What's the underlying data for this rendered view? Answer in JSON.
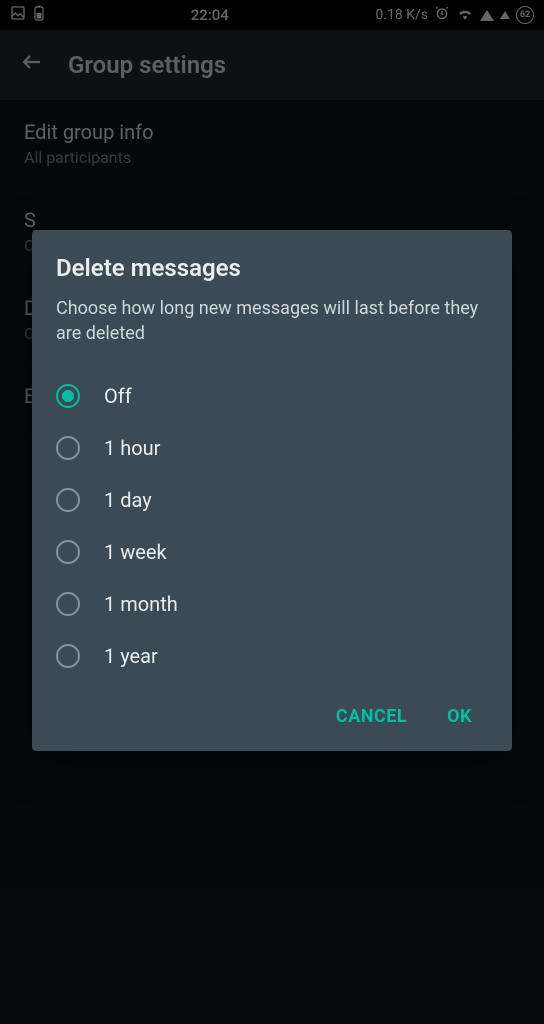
{
  "statusbar": {
    "time": "22:04",
    "network_speed": "0.18 K/s",
    "battery_pct": "62"
  },
  "header": {
    "title": "Group settings"
  },
  "settings": [
    {
      "title": "Edit group info",
      "subtitle": "All participants"
    },
    {
      "title": "S",
      "subtitle": "O"
    },
    {
      "title": "D",
      "subtitle": "O"
    },
    {
      "title": "E",
      "subtitle": ""
    }
  ],
  "dialog": {
    "title": "Delete messages",
    "description": "Choose how long new messages will last before they are deleted",
    "options": [
      {
        "label": "Off",
        "selected": true
      },
      {
        "label": "1 hour",
        "selected": false
      },
      {
        "label": "1 day",
        "selected": false
      },
      {
        "label": "1 week",
        "selected": false
      },
      {
        "label": "1 month",
        "selected": false
      },
      {
        "label": "1 year",
        "selected": false
      }
    ],
    "cancel_label": "CANCEL",
    "ok_label": "OK"
  }
}
